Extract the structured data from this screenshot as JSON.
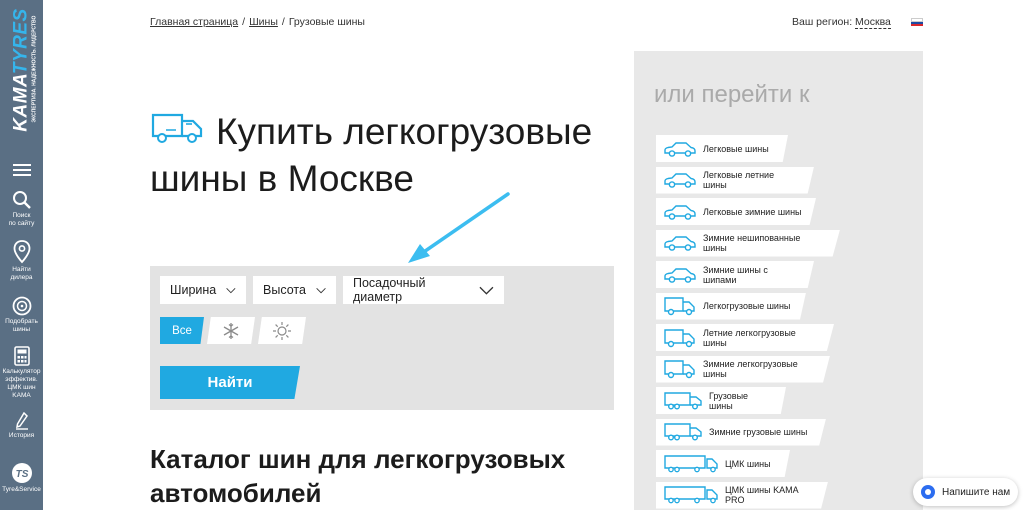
{
  "sidebar": {
    "logo_main": "KAMA",
    "logo_accent": "TYRES",
    "logo_sub": "ЭКСПЕРТИЗА. НАДЕЖНОСТЬ. ЛИДЕРСТВО",
    "items": [
      {
        "icon": "menu-icon",
        "label": ""
      },
      {
        "icon": "search-icon",
        "label": "Поиск\nпо сайту"
      },
      {
        "icon": "map-pin-icon",
        "label": "Найти\nдилера"
      },
      {
        "icon": "tire-icon",
        "label": "Подобрать\nшины"
      },
      {
        "icon": "calculator-icon",
        "label": "Калькулятор\nэффектив.\nЦМК шин\nKAMA"
      },
      {
        "icon": "history-icon",
        "label": "История"
      },
      {
        "icon": "ts-logo-icon",
        "label": "Tyre&Service"
      }
    ]
  },
  "breadcrumbs": {
    "home": "Главная страница",
    "tires": "Шины",
    "current": "Грузовые шины",
    "sep": "/"
  },
  "region": {
    "label": "Ваш регион:",
    "city": "Москва"
  },
  "page": {
    "title": "Купить легкогрузовые шины в Москве",
    "catalog_title": "Каталог шин для легкогрузовых автомобилей"
  },
  "filter": {
    "width_label": "Ширина",
    "height_label": "Высота",
    "diameter_label": "Посадочный диаметр",
    "season_all": "Все",
    "find_label": "Найти"
  },
  "goto": {
    "title": "или перейти к",
    "items": [
      {
        "label": "Легковые шины",
        "icon": "car-icon"
      },
      {
        "label": "Легковые летние шины",
        "icon": "car-icon"
      },
      {
        "label": "Легковые зимние шины",
        "icon": "car-icon"
      },
      {
        "label": "Зимние нешипованные шины",
        "icon": "car-icon"
      },
      {
        "label": "Зимние шины с шипами",
        "icon": "car-icon"
      },
      {
        "label": "Легкогрузовые шины",
        "icon": "van-icon"
      },
      {
        "label": "Летние легкогрузовые шины",
        "icon": "van-icon"
      },
      {
        "label": "Зимние легкогрузовые шины",
        "icon": "van-icon"
      },
      {
        "label": "Грузовые шины",
        "icon": "truck-icon"
      },
      {
        "label": "Зимние грузовые шины",
        "icon": "truck-icon"
      },
      {
        "label": "ЦМК шины",
        "icon": "semi-truck-icon"
      },
      {
        "label": "ЦМК шины KAMA PRO",
        "icon": "semi-truck-icon"
      }
    ]
  },
  "chat": {
    "label": "Напишите нам"
  },
  "colors": {
    "accent": "#20a9e1",
    "sidebar": "#5a6f84",
    "panel": "#e8e8e8"
  }
}
